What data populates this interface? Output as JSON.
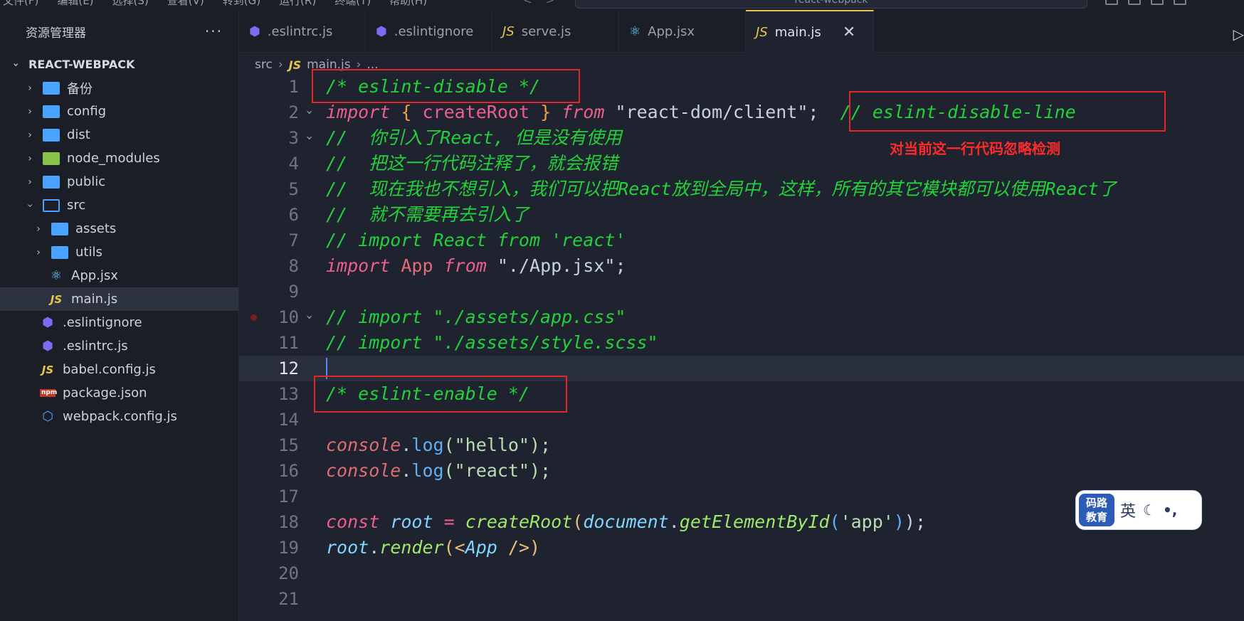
{
  "menubar": {
    "items": [
      "文件(F)",
      "编辑(E)",
      "选择(S)",
      "查看(V)",
      "转到(G)",
      "运行(R)",
      "终端(T)",
      "帮助(H)"
    ],
    "command_center": "react-webpack"
  },
  "sidebar": {
    "title": "资源管理器",
    "more": "···",
    "project": "REACT-WEBPACK",
    "items": [
      {
        "label": "备份"
      },
      {
        "label": "config"
      },
      {
        "label": "dist"
      },
      {
        "label": "node_modules"
      },
      {
        "label": "public"
      },
      {
        "label": "src"
      },
      {
        "label": "assets"
      },
      {
        "label": "utils"
      },
      {
        "label": "App.jsx"
      },
      {
        "label": "main.js"
      },
      {
        "label": ".eslintignore"
      },
      {
        "label": ".eslintrc.js"
      },
      {
        "label": "babel.config.js"
      },
      {
        "label": "package.json"
      },
      {
        "label": "webpack.config.js"
      }
    ]
  },
  "tabs": [
    {
      "label": ".eslintrc.js",
      "icon": "eslint-icon"
    },
    {
      "label": ".eslintignore",
      "icon": "eslint-icon"
    },
    {
      "label": "serve.js",
      "icon": "js-icon"
    },
    {
      "label": "App.jsx",
      "icon": "react-icon"
    },
    {
      "label": "main.js",
      "icon": "js-icon",
      "active": true
    }
  ],
  "breadcrumb": {
    "folder": "src",
    "file": "main.js",
    "more": "..."
  },
  "editor": {
    "line_numbers": [
      "1",
      "2",
      "3",
      "4",
      "5",
      "6",
      "7",
      "8",
      "9",
      "10",
      "11",
      "12",
      "13",
      "14",
      "15",
      "16",
      "17",
      "18",
      "19",
      "20",
      "21"
    ],
    "current_line": 12,
    "lines": {
      "l1": "/* eslint-disable */",
      "l2_import": "import",
      "l2_open": "{",
      "l2_name": "createRoot",
      "l2_close": "}",
      "l2_from": "from",
      "l2_module": "\"react-dom/client\"",
      "l2_semi": ";",
      "l2_comment": "// eslint-disable-line",
      "l3": "//  你引入了React, 但是没有使用",
      "l4": "//  把这一行代码注释了，就会报错",
      "l5": "//  现在我也不想引入，我们可以把React放到全局中，这样，所有的其它模块都可以使用React了",
      "l6": "//  就不需要再去引入了",
      "l7": "// import React from 'react'",
      "l8_import": "import",
      "l8_name": "App",
      "l8_from": "from",
      "l8_module": "\"./App.jsx\";",
      "l10": "// import \"./assets/app.css\"",
      "l11": "// import \"./assets/style.scss\"",
      "l13": "/* eslint-enable */",
      "l15_obj": "console",
      "l15_method": "log",
      "l15_arg": "(\"hello\");",
      "l16_obj": "console",
      "l16_method": "log",
      "l16_arg": "(\"react\");",
      "l18_const": "const",
      "l18_var": "root",
      "l18_eq": "=",
      "l18_fn": "createRoot",
      "l18_doc": "document",
      "l18_method": "getElementById",
      "l18_arg": "'app'",
      "l18_end": ");",
      "l19_var": "root",
      "l19_method": "render",
      "l19_jsx_open": "(<",
      "l19_jsx": "App",
      "l19_jsx_close": " />)"
    }
  },
  "annotation": {
    "text": "对当前这一行代码忽略检测",
    "color": "#e4262b"
  },
  "ime": {
    "logo_line1": "码路",
    "logo_line2": "教育",
    "lang": "英",
    "moon": "☾",
    "punct": "•,"
  }
}
